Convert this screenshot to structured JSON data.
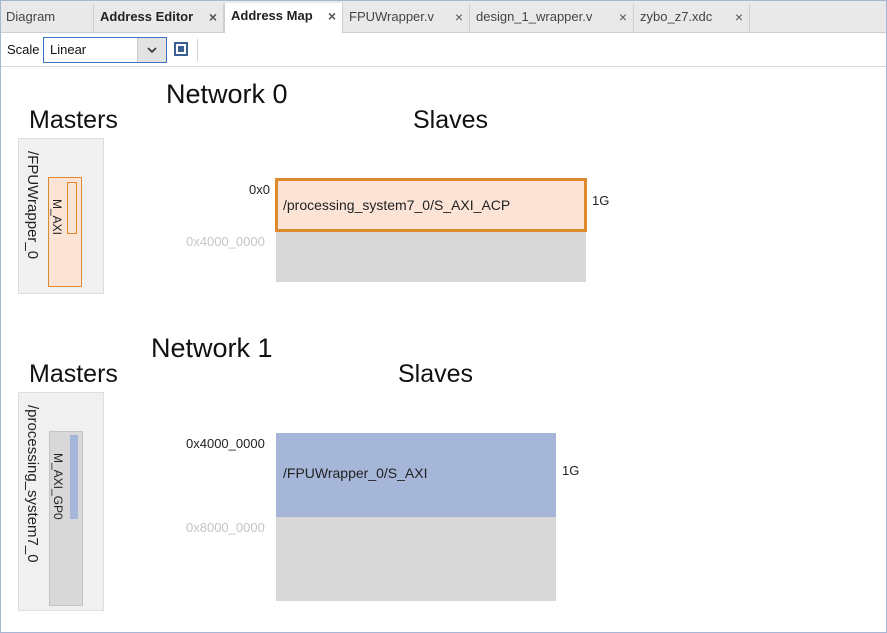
{
  "tabs": [
    {
      "label": "Diagram"
    },
    {
      "label": "Address Editor"
    },
    {
      "label": "Address Map"
    },
    {
      "label": "FPUWrapper.v"
    },
    {
      "label": "design_1_wrapper.v"
    },
    {
      "label": "zybo_z7.xdc"
    }
  ],
  "toolbar": {
    "scale_label": "Scale",
    "scale_value": "Linear"
  },
  "networks": [
    {
      "title": "Network 0",
      "masters_title": "Masters",
      "slaves_title": "Slaves",
      "master_name": "/FPUWrapper_0",
      "master_port": "M_AXI",
      "start_addr": "0x0",
      "end_addr": "0x4000_0000",
      "segment": "/processing_system7_0/S_AXI_ACP",
      "size": "1G"
    },
    {
      "title": "Network 1",
      "masters_title": "Masters",
      "slaves_title": "Slaves",
      "master_name": "/processing_system7_0",
      "master_port": "M_AXI_GP0",
      "start_addr": "0x4000_0000",
      "end_addr": "0x8000_0000",
      "segment": "/FPUWrapper_0/S_AXI",
      "size": "1G"
    }
  ],
  "colors": {
    "acp_fill": "#fbe3d6",
    "acp_border": "#de8a2f",
    "gp0_fill": "#a5b6d8",
    "gray_fill": "#d8d8d8",
    "accent": "#3b73c5"
  },
  "icons": {
    "close": "×",
    "dropdown": "chevron-down",
    "fit": "fit-to-window"
  }
}
